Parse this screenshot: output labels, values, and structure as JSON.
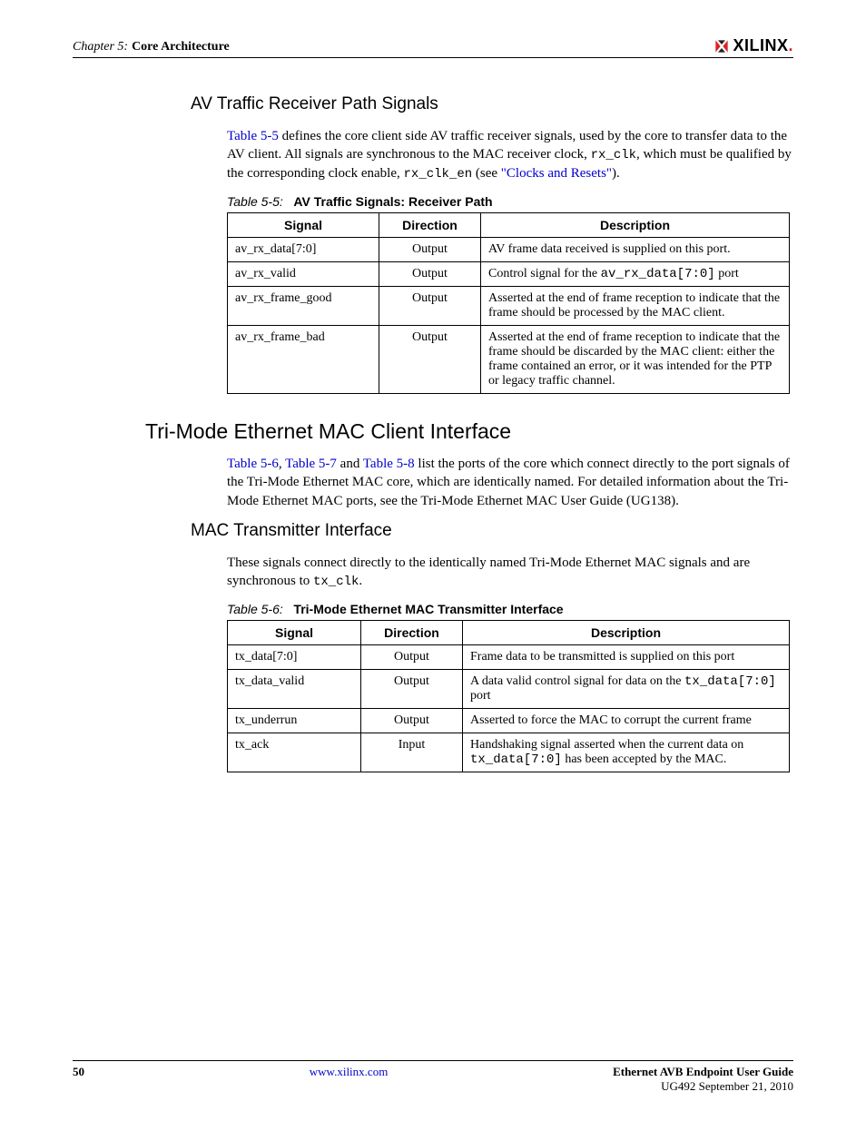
{
  "header": {
    "chapter_prefix": "Chapter 5:",
    "chapter_title": "Core Architecture",
    "logo_text": "XILINX"
  },
  "section1": {
    "heading": "AV Traffic Receiver Path Signals",
    "para_link1": "Table 5-5",
    "para_text1": " defines the core client side AV traffic receiver signals, used by the core to transfer data to the AV client. All signals are synchronous to the MAC receiver clock, ",
    "para_mono1": "rx_clk",
    "para_text2": ", which must be qualified by the corresponding clock enable, ",
    "para_mono2": "rx_clk_en",
    "para_text3": " (see ",
    "para_link2": "\"Clocks and Resets\"",
    "para_text4": ")."
  },
  "table55": {
    "caption_ref": "Table 5-5:",
    "caption_title": "AV Traffic Signals: Receiver Path",
    "headers": [
      "Signal",
      "Direction",
      "Description"
    ],
    "rows": [
      {
        "signal": "av_rx_data[7:0]",
        "direction": "Output",
        "desc_pre": "AV frame data received is supplied on this port.",
        "desc_mono": "",
        "desc_post": ""
      },
      {
        "signal": "av_rx_valid",
        "direction": "Output",
        "desc_pre": "Control signal for the ",
        "desc_mono": "av_rx_data[7:0]",
        "desc_post": " port"
      },
      {
        "signal": "av_rx_frame_good",
        "direction": "Output",
        "desc_pre": "Asserted at the end of frame reception to indicate that the frame should be processed by the MAC client.",
        "desc_mono": "",
        "desc_post": ""
      },
      {
        "signal": "av_rx_frame_bad",
        "direction": "Output",
        "desc_pre": "Asserted at the end of frame reception to indicate that the frame should be discarded by the MAC client: either the frame contained an error, or it was intended for the PTP or legacy traffic channel.",
        "desc_mono": "",
        "desc_post": ""
      }
    ]
  },
  "section2": {
    "heading": "Tri-Mode Ethernet MAC Client Interface",
    "para_link1": "Table 5-6",
    "para_sep1": ", ",
    "para_link2": "Table 5-7",
    "para_sep2": " and ",
    "para_link3": "Table 5-8",
    "para_text1": " list the ports of the core which connect directly to the port signals of the Tri-Mode Ethernet MAC core, which are identically named. For detailed information about the Tri-Mode Ethernet MAC ports, see the Tri-Mode Ethernet MAC User Guide (UG138)."
  },
  "section3": {
    "heading": "MAC Transmitter Interface",
    "para_text1": "These signals connect directly to the identically named Tri-Mode Ethernet MAC signals and are synchronous to ",
    "para_mono1": "tx_clk",
    "para_text2": "."
  },
  "table56": {
    "caption_ref": "Table 5-6:",
    "caption_title": "Tri-Mode Ethernet MAC Transmitter Interface",
    "headers": [
      "Signal",
      "Direction",
      "Description"
    ],
    "rows": [
      {
        "signal": "tx_data[7:0]",
        "direction": "Output",
        "desc_pre": "Frame data to be transmitted is supplied on this port",
        "desc_mono": "",
        "desc_post": ""
      },
      {
        "signal": "tx_data_valid",
        "direction": "Output",
        "desc_pre": "A data valid control signal for data on the ",
        "desc_mono": "tx_data[7:0]",
        "desc_post": " port"
      },
      {
        "signal": "tx_underrun",
        "direction": "Output",
        "desc_pre": "Asserted to force the MAC to corrupt the current frame",
        "desc_mono": "",
        "desc_post": ""
      },
      {
        "signal": "tx_ack",
        "direction": "Input",
        "desc_pre": "Handshaking signal asserted when the current data on ",
        "desc_mono": "tx_data[7:0]",
        "desc_post": " has been accepted by the MAC."
      }
    ]
  },
  "footer": {
    "page_no": "50",
    "url": "www.xilinx.com",
    "doc_title": "Ethernet AVB Endpoint User Guide",
    "doc_ref": "UG492 September 21, 2010"
  }
}
